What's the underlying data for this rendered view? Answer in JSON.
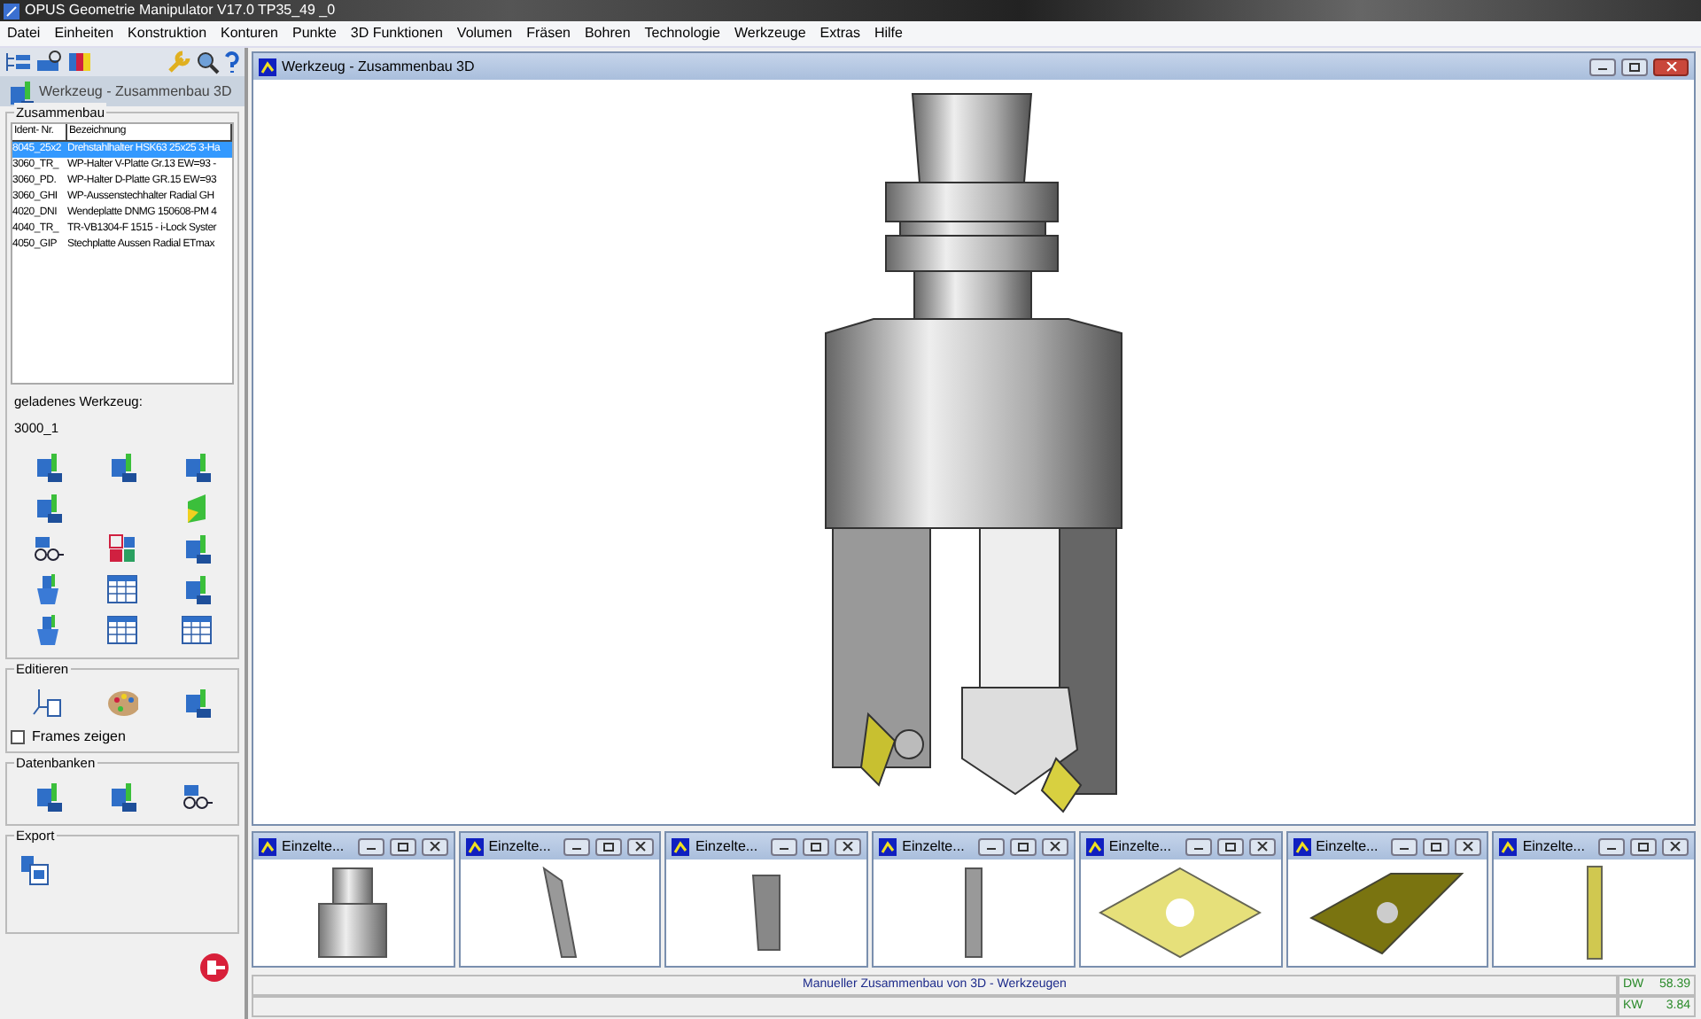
{
  "window": {
    "title": "OPUS Geometrie Manipulator V17.0   TP35_49          _0"
  },
  "menu": [
    "Datei",
    "Einheiten",
    "Konstruktion",
    "Konturen",
    "Punkte",
    "3D Funktionen",
    "Volumen",
    "Fräsen",
    "Bohren",
    "Technologie",
    "Werkzeuge",
    "Extras",
    "Hilfe"
  ],
  "sidebar": {
    "title": "Werkzeug - Zusammenbau 3D",
    "assembly": {
      "title": "Zusammenbau",
      "columns": [
        "Ident- Nr.",
        "Bezeichnung"
      ],
      "rows": [
        {
          "ident": "8045_25x2",
          "name": "Drehstahlhalter HSK63 25x25 3-Ha",
          "selected": true
        },
        {
          "ident": "3060_TR_",
          "name": "WP-Halter V-Platte Gr.13 EW=93 -",
          "selected": false
        },
        {
          "ident": "3060_PD.",
          "name": "WP-Halter D-Platte GR.15 EW=93",
          "selected": false
        },
        {
          "ident": "3060_GHI",
          "name": "WP-Aussenstechhalter Radial GH",
          "selected": false
        },
        {
          "ident": "4020_DNI",
          "name": "Wendeplatte DNMG 150608-PM 4",
          "selected": false
        },
        {
          "ident": "4040_TR_",
          "name": "TR-VB1304-F 1515 - i-Lock Syster",
          "selected": false
        },
        {
          "ident": "4050_GIP",
          "name": "Stechplatte Aussen Radial ETmax",
          "selected": false
        }
      ],
      "loaded_label": "geladenes Werkzeug:",
      "loaded_value": "3000_1"
    },
    "edit": {
      "title": "Editieren",
      "frames": {
        "label": "Frames zeigen",
        "checked": false
      }
    },
    "databases": {
      "title": "Datenbanken"
    },
    "export": {
      "title": "Export"
    }
  },
  "main_window": {
    "title": "Werkzeug - Zusammenbau 3D"
  },
  "thumbnails": [
    {
      "title": "Einzelte..."
    },
    {
      "title": "Einzelte..."
    },
    {
      "title": "Einzelte..."
    },
    {
      "title": "Einzelte..."
    },
    {
      "title": "Einzelte..."
    },
    {
      "title": "Einzelte..."
    },
    {
      "title": "Einzelte..."
    }
  ],
  "status_bar": {
    "message": "Manueller Zusammenbau von 3D - Werkzeugen",
    "readings": [
      {
        "label": "DW",
        "value": "58.39"
      },
      {
        "label": "KW",
        "value": "3.84"
      }
    ]
  }
}
